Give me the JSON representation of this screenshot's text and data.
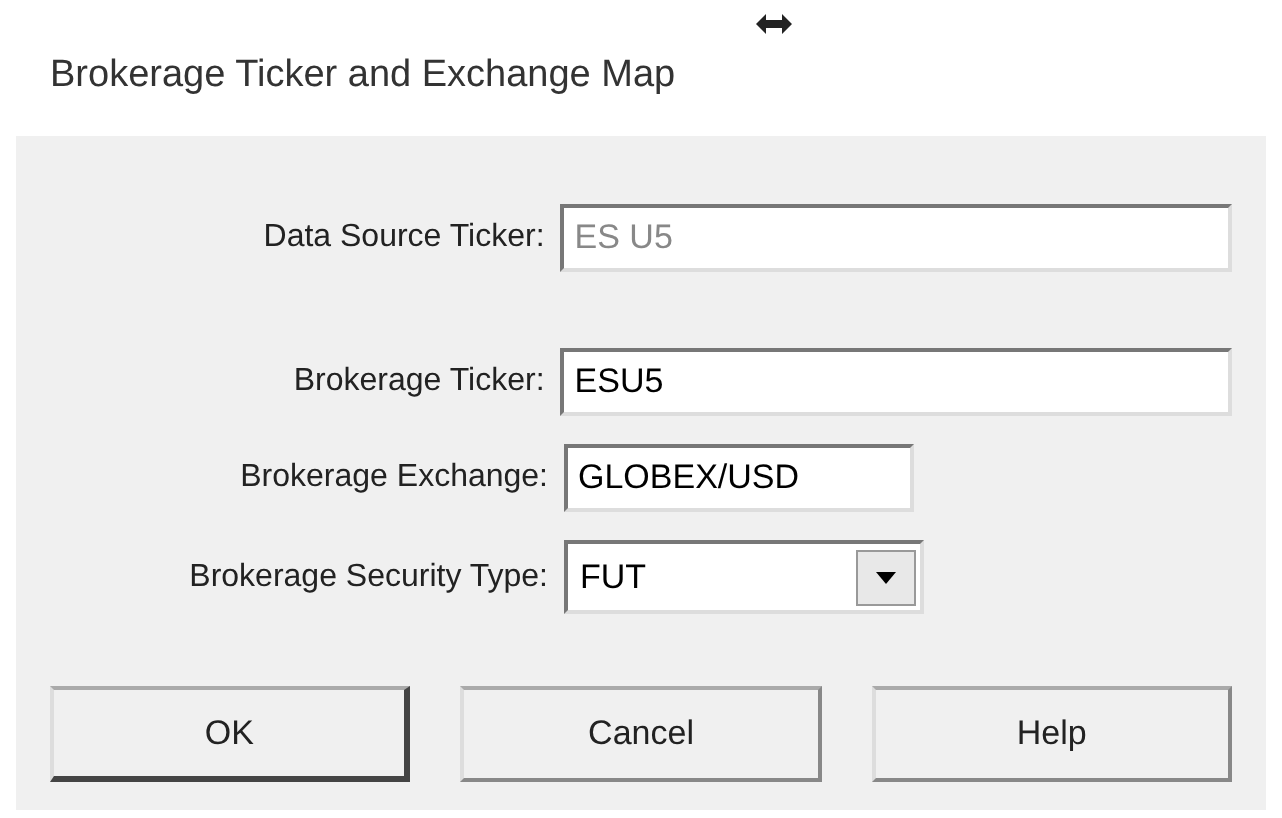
{
  "window": {
    "title": "Brokerage Ticker and Exchange Map"
  },
  "fields": [
    {
      "kind": "text",
      "label": "Data Source Ticker:",
      "value": "ES U5",
      "disabled": true
    },
    {
      "kind": "text",
      "label": "Brokerage Ticker:",
      "value": "ESU5",
      "disabled": false
    },
    {
      "kind": "text",
      "label": "Brokerage Exchange:",
      "value": "GLOBEX/USD",
      "disabled": false
    },
    {
      "kind": "combo",
      "label": "Brokerage Security Type:",
      "value": "FUT"
    }
  ],
  "buttons": [
    {
      "label": "OK",
      "default": true
    },
    {
      "label": "Cancel",
      "default": false
    },
    {
      "label": "Help",
      "default": false
    }
  ]
}
